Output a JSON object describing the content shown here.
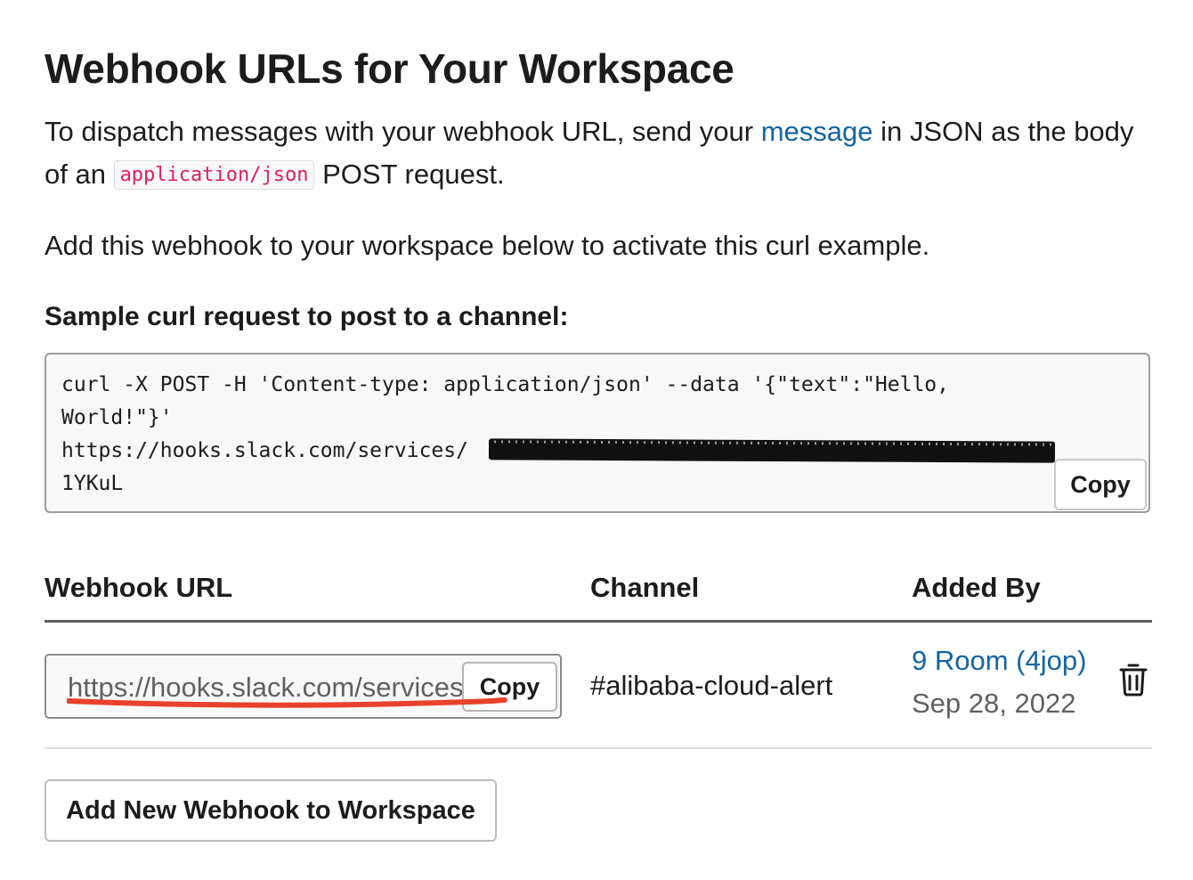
{
  "page": {
    "title": "Webhook URLs for Your Workspace",
    "intro_before": "To dispatch messages with your webhook URL, send your ",
    "intro_link": "message",
    "intro_middle": " in JSON as the body of an ",
    "intro_code": "application/json",
    "intro_after": " POST request.",
    "activate_text": "Add this webhook to your workspace below to activate this curl example."
  },
  "sample": {
    "heading": "Sample curl request to post to a channel:",
    "code_line1": "curl -X POST -H 'Content-type: application/json' --data '{\"text\":\"Hello,",
    "code_line2": "World!\"}'",
    "code_line3": "https://hooks.slack.com/services/",
    "code_line4": "1YKuL",
    "copy_label": "Copy"
  },
  "table": {
    "headers": {
      "url": "Webhook URL",
      "channel": "Channel",
      "added_by": "Added By"
    },
    "row": {
      "url_value": "https://hooks.slack.com/services/",
      "copy_label": "Copy",
      "channel": "#alibaba-cloud-alert",
      "added_by_user": "9 Room (4jop)",
      "added_date": "Sep 28, 2022"
    }
  },
  "actions": {
    "add_webhook_label": "Add New Webhook to Workspace"
  },
  "colors": {
    "link": "#1264a3",
    "inline_code": "#e01e5a",
    "annotation_underline": "#e8412c"
  },
  "icons": {
    "delete": "trash-icon"
  }
}
